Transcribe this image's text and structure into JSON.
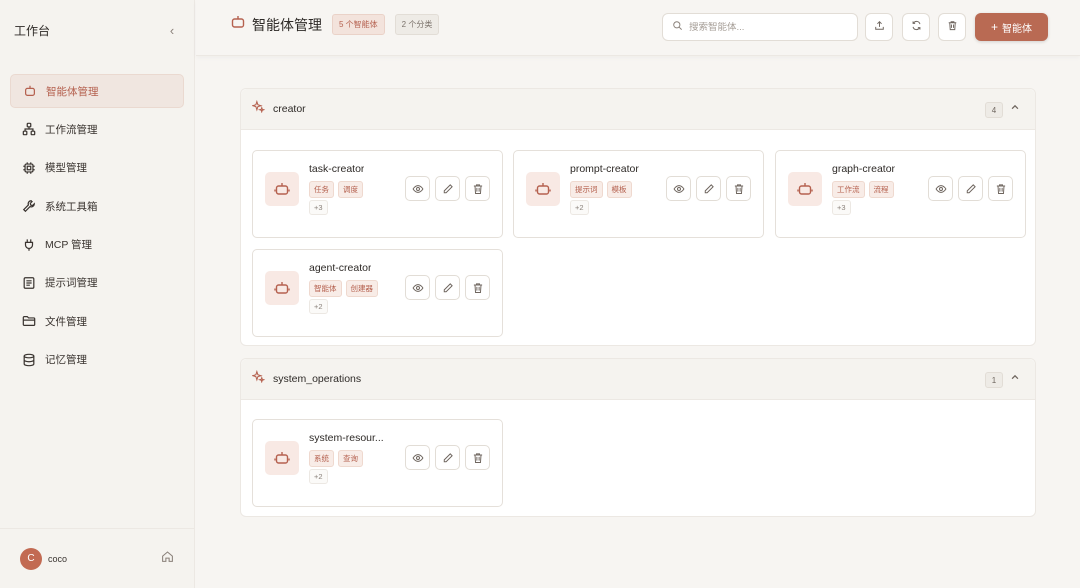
{
  "sidebar": {
    "title": "工作台",
    "collapse_glyph": "‹",
    "items": [
      {
        "label": "智能体管理",
        "icon": "robot-icon",
        "active": true
      },
      {
        "label": "工作流管理",
        "icon": "workflow-icon"
      },
      {
        "label": "模型管理",
        "icon": "chip-icon"
      },
      {
        "label": "系统工具箱",
        "icon": "wrench-icon"
      },
      {
        "label": "MCP 管理",
        "icon": "plug-icon"
      },
      {
        "label": "提示词管理",
        "icon": "document-icon"
      },
      {
        "label": "文件管理",
        "icon": "folder-icon"
      },
      {
        "label": "记忆管理",
        "icon": "database-icon"
      }
    ],
    "user": {
      "initial": "C",
      "name": "coco"
    }
  },
  "header": {
    "title": "智能体管理",
    "agent_count_badge": "5 个智能体",
    "category_count_badge": "2 个分类",
    "search_placeholder": "搜索智能体...",
    "add_button_plus": "+",
    "add_button_label": "智能体"
  },
  "groups": [
    {
      "name": "creator",
      "count": "4",
      "cards": [
        {
          "name": "task-creator",
          "tags": [
            "任务",
            "调度"
          ],
          "more": "+3"
        },
        {
          "name": "prompt-creator",
          "tags": [
            "提示词",
            "模板"
          ],
          "more": "+2"
        },
        {
          "name": "graph-creator",
          "tags": [
            "工作流",
            "流程"
          ],
          "more": "+3"
        },
        {
          "name": "agent-creator",
          "tags": [
            "智能体",
            "创建器"
          ],
          "more": "+2"
        }
      ]
    },
    {
      "name": "system_operations",
      "count": "1",
      "cards": [
        {
          "name": "system-resour...",
          "tags": [
            "系统",
            "查询"
          ],
          "more": "+2"
        }
      ]
    }
  ],
  "colors": {
    "accent": "#b96a53",
    "background": "#f7f5f2",
    "sidebar_active_bg": "#f0e6e0"
  }
}
